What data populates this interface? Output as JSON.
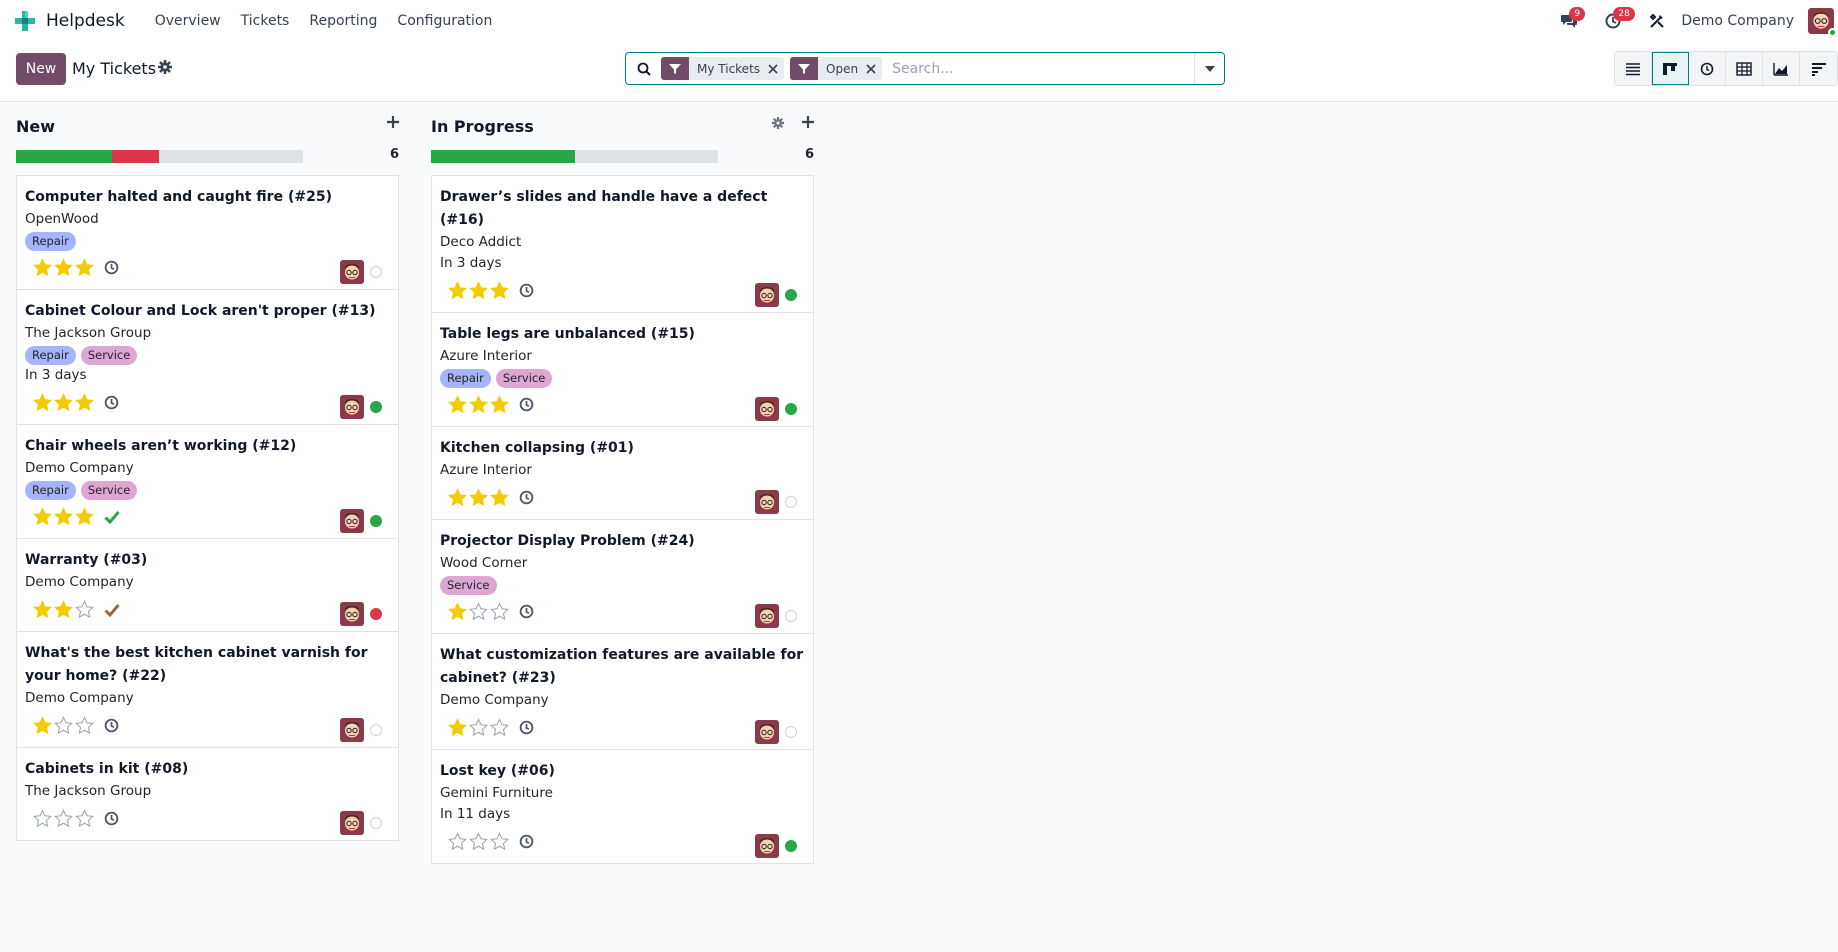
{
  "app": {
    "name": "Helpdesk",
    "nav": [
      "Overview",
      "Tickets",
      "Reporting",
      "Configuration"
    ]
  },
  "systray": {
    "messages_count": "9",
    "activities_count": "28",
    "company": "Demo Company"
  },
  "control": {
    "new_label": "New",
    "title": "My Tickets",
    "facets": [
      "My Tickets",
      "Open"
    ],
    "search_placeholder": "Search..."
  },
  "views": [
    "list-view-icon",
    "kanban-view-icon",
    "activity-view-icon",
    "pivot-view-icon",
    "graph-view-icon",
    "cohort-view-icon"
  ],
  "colors": {
    "brand": "#714b67",
    "accent": "#017e84",
    "success": "#28a745",
    "danger": "#dc3545",
    "star": "#f3cc00",
    "tag_repair": "#a5b4fc",
    "tag_service": "#dfa6d4"
  },
  "columns": [
    {
      "title": "New",
      "count": "6",
      "progress": {
        "green": 2,
        "red": 1,
        "gray": 3
      },
      "cards": [
        {
          "title": "Computer halted and caught fire (#25)",
          "company": "OpenWood",
          "tags": [
            "Repair"
          ],
          "deadline": "",
          "stars": 3,
          "activity": "clock",
          "state": "normal"
        },
        {
          "title": "Cabinet Colour and Lock aren't proper (#13)",
          "company": "The Jackson Group",
          "tags": [
            "Repair",
            "Service"
          ],
          "deadline": "In 3 days",
          "stars": 3,
          "activity": "clock",
          "state": "done"
        },
        {
          "title": "Chair wheels aren’t working (#12)",
          "company": "Demo Company",
          "tags": [
            "Repair",
            "Service"
          ],
          "deadline": "",
          "stars": 3,
          "activity": "check-green",
          "state": "done"
        },
        {
          "title": "Warranty (#03)",
          "company": "Demo Company",
          "tags": [],
          "deadline": "",
          "stars": 2,
          "activity": "check-brown",
          "state": "blocked"
        },
        {
          "title": "What's the best kitchen cabinet varnish for your home? (#22)",
          "company": "Demo Company",
          "tags": [],
          "deadline": "",
          "stars": 1,
          "activity": "clock",
          "state": "normal"
        },
        {
          "title": "Cabinets in kit (#08)",
          "company": "The Jackson Group",
          "tags": [],
          "deadline": "",
          "stars": 0,
          "activity": "clock",
          "state": "normal"
        }
      ]
    },
    {
      "title": "In Progress",
      "count": "6",
      "progress": {
        "green": 3,
        "red": 0,
        "gray": 3
      },
      "cards": [
        {
          "title": "Drawer’s slides and handle have a defect (#16)",
          "company": "Deco Addict",
          "tags": [],
          "deadline": "In 3 days",
          "stars": 3,
          "activity": "clock",
          "state": "done"
        },
        {
          "title": "Table legs are unbalanced (#15)",
          "company": "Azure Interior",
          "tags": [
            "Repair",
            "Service"
          ],
          "deadline": "",
          "stars": 3,
          "activity": "clock",
          "state": "done"
        },
        {
          "title": "Kitchen collapsing (#01)",
          "company": "Azure Interior",
          "tags": [],
          "deadline": "",
          "stars": 3,
          "activity": "clock",
          "state": "normal"
        },
        {
          "title": "Projector Display Problem (#24)",
          "company": "Wood Corner",
          "tags": [
            "Service"
          ],
          "deadline": "",
          "stars": 1,
          "activity": "clock",
          "state": "normal"
        },
        {
          "title": "What customization features are available for cabinet? (#23)",
          "company": "Demo Company",
          "tags": [],
          "deadline": "",
          "stars": 1,
          "activity": "clock",
          "state": "normal"
        },
        {
          "title": "Lost key (#06)",
          "company": "Gemini Furniture",
          "tags": [],
          "deadline": "In 11 days",
          "stars": 0,
          "activity": "clock",
          "state": "done"
        }
      ]
    }
  ]
}
